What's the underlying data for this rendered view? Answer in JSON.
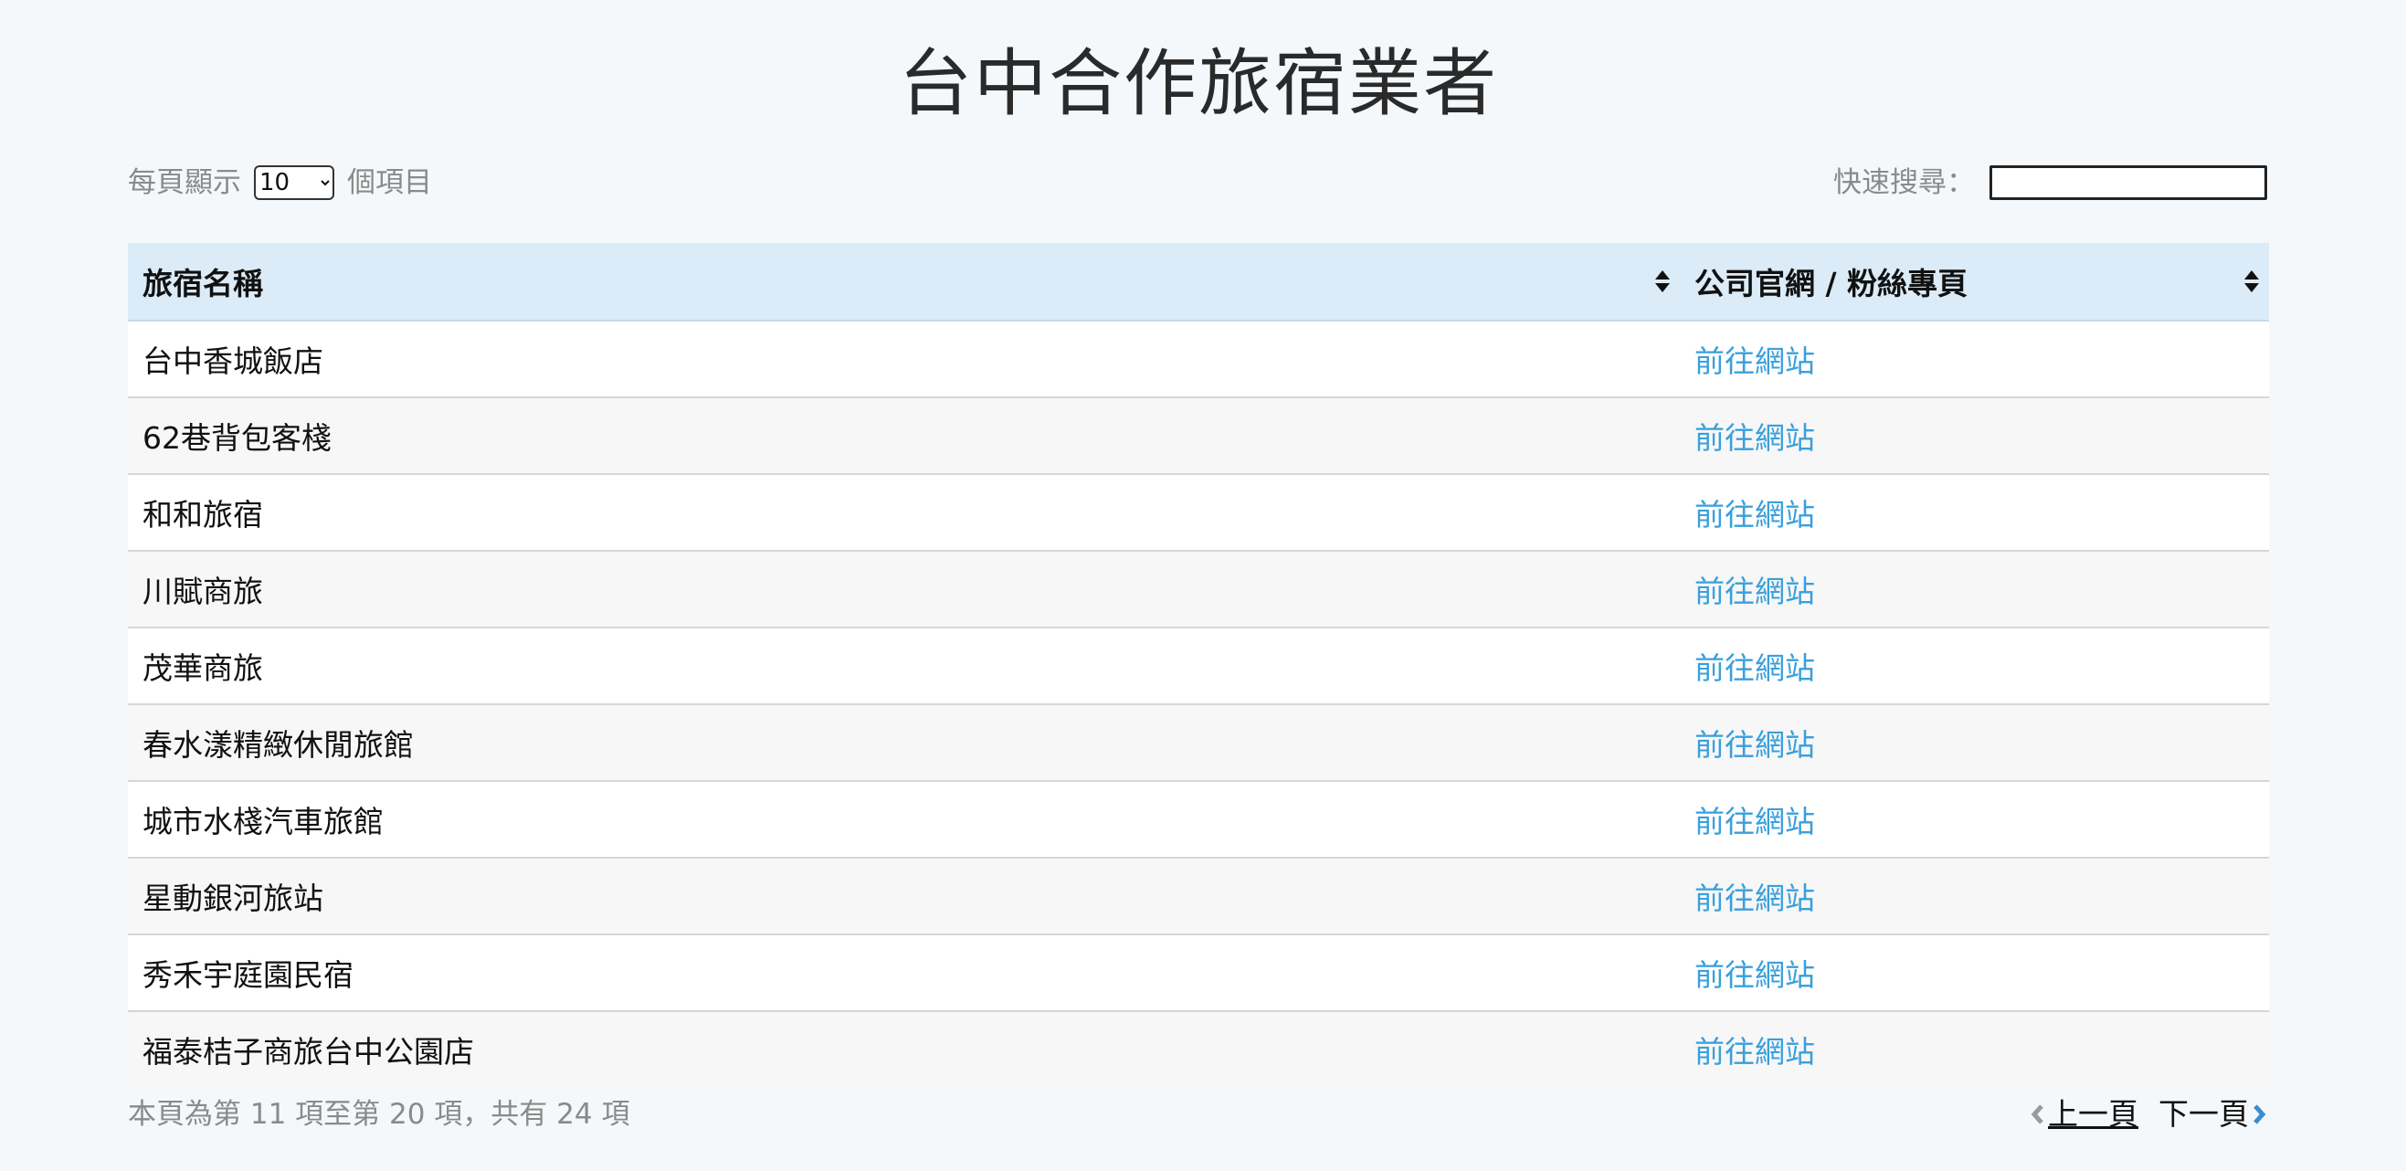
{
  "title": "台中合作旅宿業者",
  "length_control": {
    "prefix": "每頁顯示",
    "selected": "10",
    "options": [
      "10"
    ],
    "suffix": "個項目"
  },
  "search": {
    "label": "快速搜尋：",
    "value": ""
  },
  "table": {
    "columns": [
      "旅宿名稱",
      "公司官網 / 粉絲專頁"
    ],
    "rows": [
      {
        "name": "台中香城飯店",
        "link": "前往網站"
      },
      {
        "name": "62巷背包客棧",
        "link": "前往網站"
      },
      {
        "name": "和和旅宿",
        "link": "前往網站"
      },
      {
        "name": "川賦商旅",
        "link": "前往網站"
      },
      {
        "name": "茂華商旅",
        "link": "前往網站"
      },
      {
        "name": "春水漾精緻休閒旅館",
        "link": "前往網站"
      },
      {
        "name": "城市水棧汽車旅館",
        "link": "前往網站"
      },
      {
        "name": "星動銀河旅站",
        "link": "前往網站"
      },
      {
        "name": "秀禾宇庭園民宿",
        "link": "前往網站"
      },
      {
        "name": "福泰桔子商旅台中公園店",
        "link": "前往網站"
      }
    ]
  },
  "info": "本頁為第 11 項至第 20 項，共有 24 項",
  "pagination": {
    "prev_label": "上一頁",
    "next_label": "下一頁",
    "prev_icon": "chevron-left-icon",
    "next_icon": "chevron-right-icon"
  },
  "colors": {
    "header_bg": "#dbebf7",
    "link": "#3a9fdc",
    "muted_text": "#8a8a8a",
    "page_bg": "#f4f8fb"
  }
}
